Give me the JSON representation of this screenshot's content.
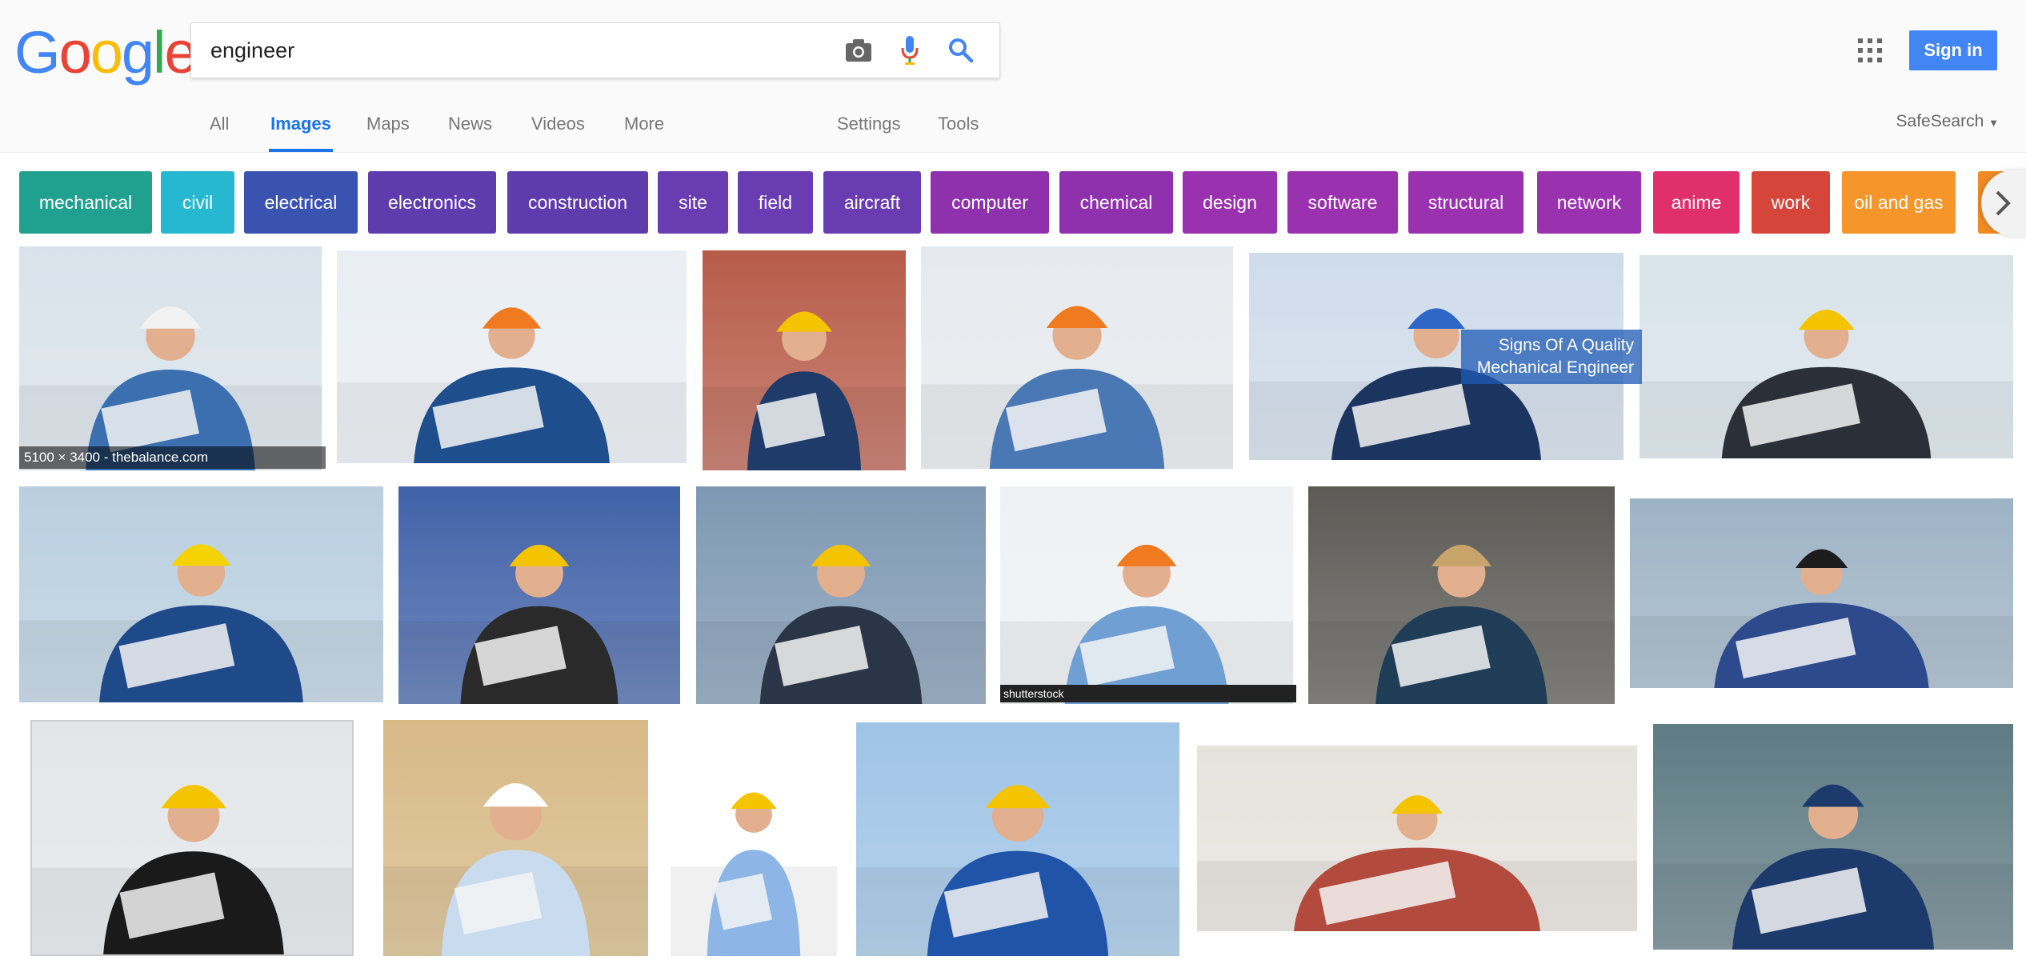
{
  "logo": {
    "letters": [
      "G",
      "o",
      "o",
      "g",
      "l",
      "e"
    ],
    "colors": [
      "#4285f4",
      "#ea4335",
      "#fbbc05",
      "#4285f4",
      "#34a853",
      "#ea4335"
    ]
  },
  "search": {
    "query": "engineer"
  },
  "header": {
    "signin_label": "Sign in"
  },
  "tabs": [
    {
      "label": "All",
      "active": false
    },
    {
      "label": "Images",
      "active": true
    },
    {
      "label": "Maps",
      "active": false
    },
    {
      "label": "News",
      "active": false
    },
    {
      "label": "Videos",
      "active": false
    },
    {
      "label": "More",
      "active": false
    },
    {
      "label": "Settings",
      "active": false
    },
    {
      "label": "Tools",
      "active": false
    }
  ],
  "safesearch_label": "SafeSearch",
  "chips": [
    {
      "label": "mechanical",
      "color": "#20a08f"
    },
    {
      "label": "civil",
      "color": "#27b8d1"
    },
    {
      "label": "electrical",
      "color": "#3b53b0"
    },
    {
      "label": "electronics",
      "color": "#5f3cad"
    },
    {
      "label": "construction",
      "color": "#5f3cad"
    },
    {
      "label": "site",
      "color": "#6a3cb2"
    },
    {
      "label": "field",
      "color": "#6a3cb2"
    },
    {
      "label": "aircraft",
      "color": "#6a3cb2"
    },
    {
      "label": "computer",
      "color": "#8f31ad"
    },
    {
      "label": "chemical",
      "color": "#8f31ad"
    },
    {
      "label": "design",
      "color": "#9a31ae"
    },
    {
      "label": "software",
      "color": "#9a31ae"
    },
    {
      "label": "structural",
      "color": "#9a31ae"
    },
    {
      "label": "network",
      "color": "#9a31ae"
    },
    {
      "label": "anime",
      "color": "#e0306b"
    },
    {
      "label": "work",
      "color": "#d6453a"
    },
    {
      "label": "oil and gas",
      "color": "#f6962a"
    },
    {
      "label": "",
      "color": "#f08a24"
    }
  ],
  "results": {
    "first_caption": "5100 × 3400 - thebalance.com",
    "overlay_text_line1": "Signs Of A Quality",
    "overlay_text_line2": "Mechanical Engineer",
    "watermark": "shutterstock"
  }
}
